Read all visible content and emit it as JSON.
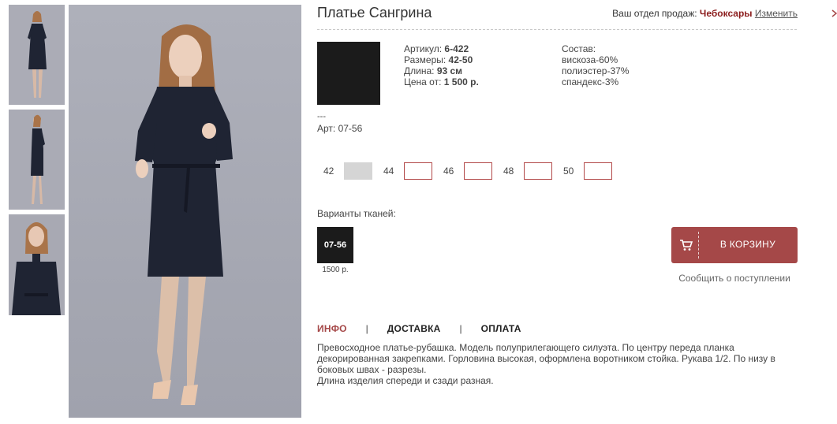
{
  "product": {
    "title": "Платье Сангрина"
  },
  "region": {
    "prefix": "Ваш отдел продаж:",
    "city": "Чебоксары",
    "change_label": "Изменить"
  },
  "specs": {
    "article_label": "Артикул:",
    "article_value": "6-422",
    "sizes_label": "Размеры:",
    "sizes_value": "42-50",
    "length_label": "Длина:",
    "length_value": "93 см",
    "price_label": "Цена от:",
    "price_value": "1 500 р."
  },
  "composition": {
    "title": "Состав:",
    "lines": [
      "вискоза-60%",
      "полиэстер-37%",
      "спандекс-3%"
    ]
  },
  "fabric_code": {
    "dashes": "---",
    "text": "Арт: 07-56"
  },
  "sizes": [
    {
      "label": "42",
      "available": false
    },
    {
      "label": "44",
      "available": true
    },
    {
      "label": "46",
      "available": true
    },
    {
      "label": "48",
      "available": true
    },
    {
      "label": "50",
      "available": true
    }
  ],
  "fabrics": {
    "title": "Варианты тканей:",
    "items": [
      {
        "code": "07-56",
        "price": "1500 р.",
        "color": "#1b1b1b"
      }
    ]
  },
  "cart": {
    "button_label": "В КОРЗИНУ",
    "notify_label": "Сообщить о поступлении"
  },
  "tabs": [
    {
      "label": "ИНФО",
      "active": true
    },
    {
      "label": "ДОСТАВКА",
      "active": false
    },
    {
      "label": "ОПЛАТА",
      "active": false
    }
  ],
  "tab_separator": "|",
  "description": {
    "line1": "Превосходное платье-рубашка. Модель полуприлегающего силуэта. По центру переда планка декорированная закрепками. Горловина высокая, оформлена воротником стойка. Рукава 1/2. По низу в боковых швах - разрезы.",
    "line2": "Длина изделия спереди и сзади разная."
  },
  "colors": {
    "accent": "#a54848",
    "city": "#8b1c1c",
    "dress": "#1f2433",
    "photo_bg": "#a6a8b3"
  },
  "icons": {
    "cart": "cart-icon",
    "edge": "chevron-icon"
  }
}
